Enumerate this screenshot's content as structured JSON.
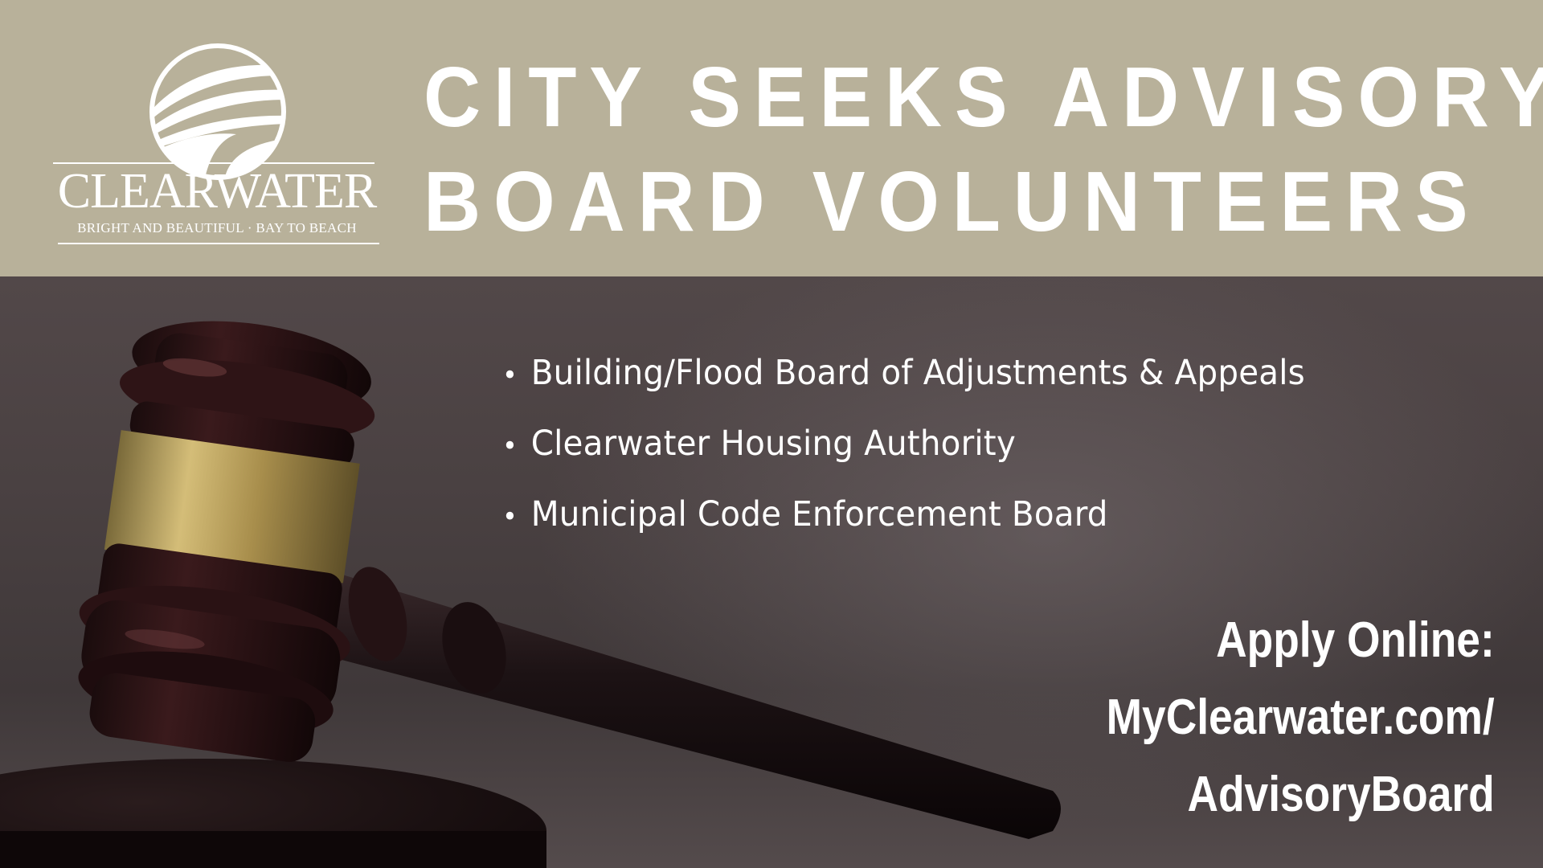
{
  "logo": {
    "icon": "clearwater-sunburst-logo-icon",
    "name": "CLEARWATER",
    "tagline": "BRIGHT AND BEAUTIFUL · BAY TO BEACH"
  },
  "headline": {
    "line1": "CITY SEEKS ADVISORY",
    "line2": "BOARD VOLUNTEERS"
  },
  "boards": [
    "Building/Flood Board of Adjustments & Appeals",
    "Clearwater Housing Authority",
    "Municipal Code Enforcement Board"
  ],
  "cta": {
    "line1": "Apply Online:",
    "line2": "MyClearwater.com/",
    "line3": "AdvisoryBoard"
  },
  "colors": {
    "header_band": "#b8b19a",
    "text": "#ffffff",
    "background": "#4a4142",
    "gavel_band": "#b8a05a"
  },
  "background_image": "gavel-photo"
}
